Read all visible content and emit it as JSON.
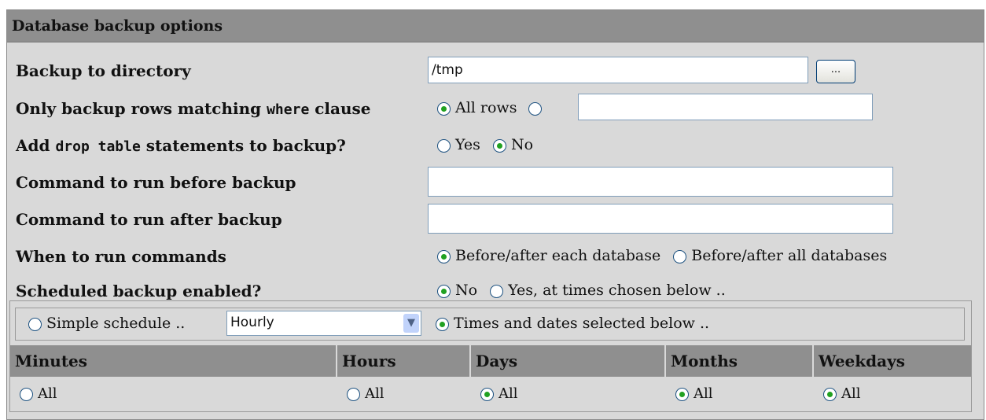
{
  "panel": {
    "title": "Database backup options"
  },
  "rows": {
    "backup_dir": {
      "label": "Backup to directory",
      "value": "/tmp",
      "button": "..."
    },
    "where_clause": {
      "label_pre": "Only backup rows matching ",
      "label_code": "where",
      "label_post": " clause",
      "opt_all": "All rows",
      "value": ""
    },
    "drop_table": {
      "label_pre": "Add ",
      "label_code": "drop table",
      "label_post": " statements to backup?",
      "opt_yes": "Yes",
      "opt_no": "No"
    },
    "cmd_before": {
      "label": "Command to run before backup",
      "value": ""
    },
    "cmd_after": {
      "label": "Command to run after backup",
      "value": ""
    },
    "when_run": {
      "label": "When to run commands",
      "opt_each": "Before/after each database",
      "opt_all": "Before/after all databases"
    },
    "scheduled": {
      "label": "Scheduled backup enabled?",
      "opt_no": "No",
      "opt_yes": "Yes, at times chosen below .."
    }
  },
  "schedule": {
    "simple_label": "Simple schedule ..",
    "simple_value": "Hourly",
    "times_label": "Times and dates selected below ..",
    "columns": [
      "Minutes",
      "Hours",
      "Days",
      "Months",
      "Weekdays"
    ],
    "all_label": "All"
  }
}
